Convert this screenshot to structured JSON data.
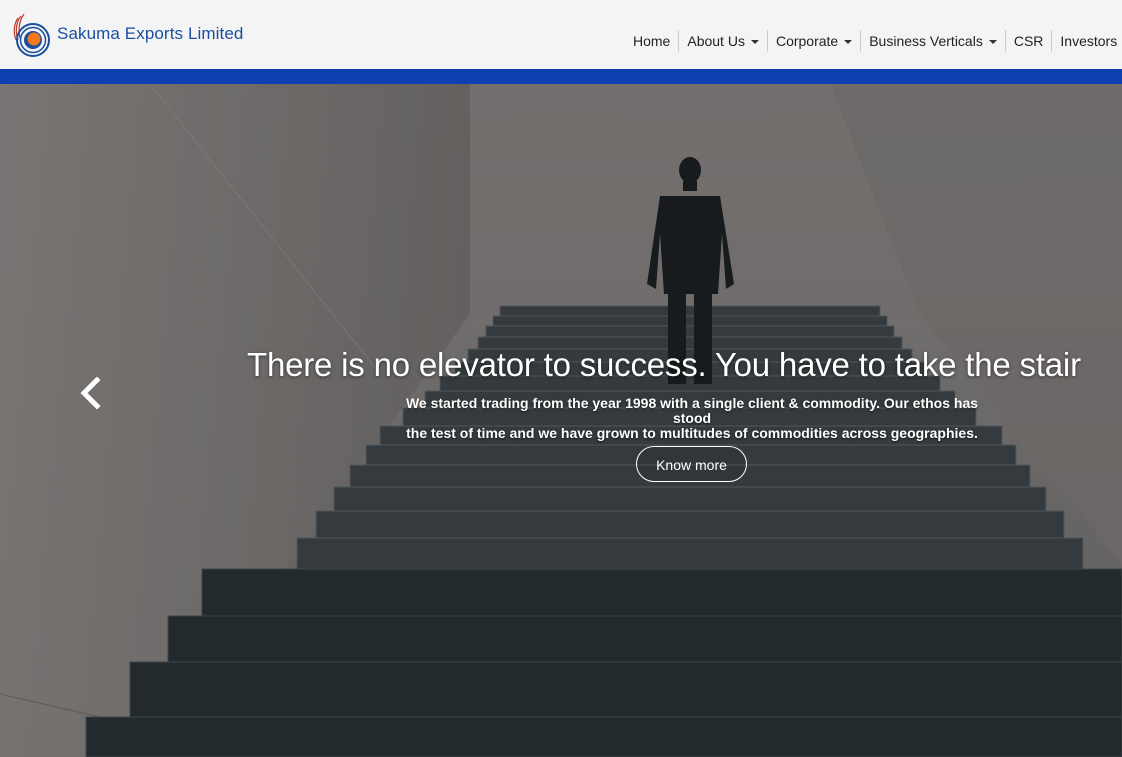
{
  "brand": {
    "name": "Sakuma Exports Limited",
    "logo_icon": "sakuma-swirl-logo",
    "colors": {
      "text": "#1a4fa0",
      "orange": "#f07a1a",
      "blue": "#1a4fa0",
      "red": "#c0392b"
    }
  },
  "nav": {
    "items": [
      {
        "label": "Home",
        "has_dropdown": false
      },
      {
        "label": "About Us",
        "has_dropdown": true
      },
      {
        "label": "Corporate",
        "has_dropdown": true
      },
      {
        "label": "Business Verticals",
        "has_dropdown": true
      },
      {
        "label": "CSR",
        "has_dropdown": false
      },
      {
        "label": "Investors",
        "has_dropdown": true
      }
    ]
  },
  "accent_bar_color": "#0f3fb0",
  "hero": {
    "headline": "There is no elevator to success. You have to take the stair",
    "subtext_line1": "We started trading from the year 1998 with a single client & commodity. Our ethos has stood",
    "subtext_line2": "the test of time and we have grown to multitudes of commodities across geographies.",
    "cta_label": "Know more",
    "prev_icon": "chevron-left-icon"
  }
}
